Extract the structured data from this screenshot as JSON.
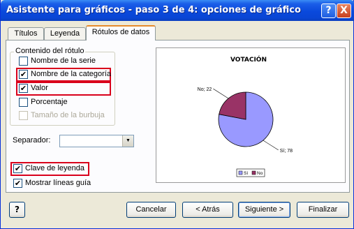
{
  "window": {
    "title": "Asistente para gráficos - paso 3 de 4: opciones de gráfico",
    "help_glyph": "?",
    "close_glyph": "X"
  },
  "tabs": [
    {
      "label": "Títulos",
      "active": false
    },
    {
      "label": "Leyenda",
      "active": false
    },
    {
      "label": "Rótulos de datos",
      "active": true
    }
  ],
  "label_contents": {
    "group_title": "Contenido del rótulo",
    "options": [
      {
        "label": "Nombre de la serie",
        "checked": false,
        "enabled": true
      },
      {
        "label": "Nombre de la categoría",
        "checked": true,
        "enabled": true
      },
      {
        "label": "Valor",
        "checked": true,
        "enabled": true
      },
      {
        "label": "Porcentaje",
        "checked": false,
        "enabled": true
      },
      {
        "label": "Tamaño de la burbuja",
        "checked": false,
        "enabled": false
      }
    ]
  },
  "separator": {
    "label": "Separador:",
    "value": "",
    "arrow": "▼"
  },
  "legend_key": {
    "label": "Clave de leyenda",
    "checked": true
  },
  "leader_lines": {
    "label": "Mostrar líneas guía",
    "checked": true
  },
  "check_glyph": "✔",
  "buttons": {
    "help": "?",
    "cancel": "Cancelar",
    "back": "< Atrás",
    "next": "Siguiente >",
    "finish": "Finalizar"
  },
  "chart_data": {
    "type": "pie",
    "title": "VOTACIÓN",
    "categories": [
      "Sí",
      "No"
    ],
    "values": [
      78,
      22
    ],
    "data_labels": [
      "Sí; 78",
      "No; 22"
    ],
    "colors": [
      "#9999ff",
      "#993366"
    ],
    "legend": [
      "Sí",
      "No"
    ],
    "legend_position": "bottom"
  }
}
